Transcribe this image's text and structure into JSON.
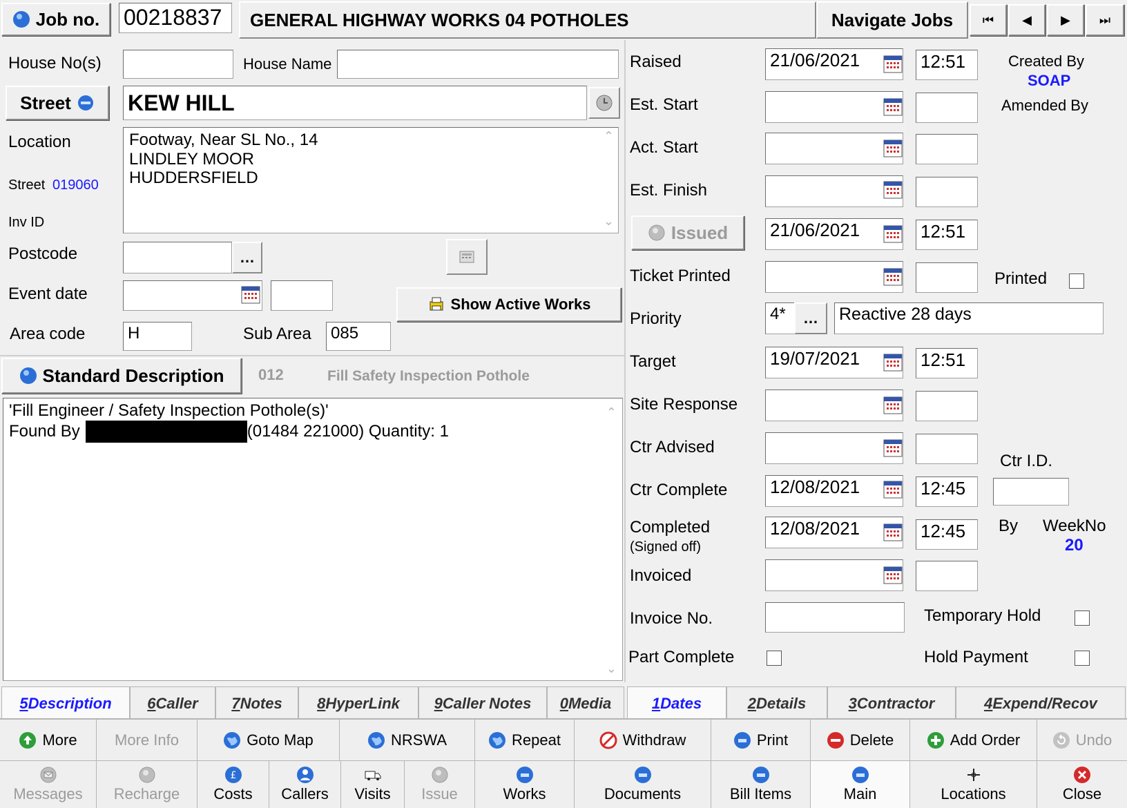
{
  "header": {
    "job_no_label": "Job no.",
    "job_no_value": "00218837",
    "job_title": "GENERAL HIGHWAY WORKS  04 POTHOLES",
    "navigate_label": "Navigate Jobs"
  },
  "address": {
    "house_nos_label": "House No(s)",
    "house_nos_value": "",
    "house_name_label": "House Name",
    "house_name_value": "",
    "street_button": "Street",
    "street_value": "KEW HILL",
    "location_label": "Location",
    "location_lines": [
      "Footway, Near SL No., 14",
      "LINDLEY MOOR",
      "HUDDERSFIELD"
    ],
    "street_code_label": "Street",
    "street_code_value": "019060",
    "inv_id_label": "Inv ID",
    "postcode_label": "Postcode",
    "postcode_value": "",
    "event_date_label": "Event date",
    "area_code_label": "Area code",
    "area_code_value": "H",
    "sub_area_label": "Sub Area",
    "sub_area_value": "085",
    "show_active_works": "Show Active Works"
  },
  "description": {
    "button": "Standard Description",
    "code": "012",
    "text": "Fill Safety Inspection Pothole",
    "body_line1": "'Fill Engineer / Safety Inspection Pothole(s)'",
    "body_line2_prefix": "Found By",
    "body_line2_suffix": "(01484 221000) Quantity: 1"
  },
  "dates": {
    "raised_label": "Raised",
    "raised_date": "21/06/2021",
    "raised_time": "12:51",
    "created_by_label": "Created By",
    "created_by_value": "SOAP",
    "amended_by_label": "Amended By",
    "est_start_label": "Est. Start",
    "act_start_label": "Act. Start",
    "est_finish_label": "Est. Finish",
    "issued_button": "Issued",
    "issued_date": "21/06/2021",
    "issued_time": "12:51",
    "ticket_printed_label": "Ticket Printed",
    "printed_label": "Printed",
    "priority_label": "Priority",
    "priority_code": "4*",
    "priority_text": "Reactive 28 days",
    "target_label": "Target",
    "target_date": "19/07/2021",
    "target_time": "12:51",
    "site_response_label": "Site Response",
    "ctr_advised_label": "Ctr Advised",
    "ctr_id_label": "Ctr I.D.",
    "ctr_complete_label": "Ctr Complete",
    "ctr_complete_date": "12/08/2021",
    "ctr_complete_time": "12:45",
    "completed_label": "Completed",
    "signed_off_label": "(Signed off)",
    "completed_date": "12/08/2021",
    "completed_time": "12:45",
    "by_label": "By",
    "weekno_label": "WeekNo",
    "weekno_value": "20",
    "invoiced_label": "Invoiced",
    "invoice_no_label": "Invoice No.",
    "temporary_hold_label": "Temporary Hold",
    "part_complete_label": "Part Complete",
    "hold_payment_label": "Hold Payment"
  },
  "tabs_left": [
    {
      "key": "5",
      "label": " Description"
    },
    {
      "key": "6",
      "label": " Caller"
    },
    {
      "key": "7",
      "label": " Notes"
    },
    {
      "key": "8",
      "label": " HyperLink"
    },
    {
      "key": "9",
      "label": " Caller Notes"
    },
    {
      "key": "0",
      "label": " Media"
    }
  ],
  "tabs_right": [
    {
      "key": "1",
      "label": " Dates"
    },
    {
      "key": "2",
      "label": " Details"
    },
    {
      "key": "3",
      "label": " Contractor"
    },
    {
      "key": "4",
      "label": " Expend/Recov"
    }
  ],
  "actions": {
    "more": "More",
    "more_info": "More Info",
    "goto_map": "Goto Map",
    "nrswa": "NRSWA",
    "repeat": "Repeat",
    "withdraw": "Withdraw",
    "print": "Print",
    "delete": "Delete",
    "add_order": "Add Order",
    "undo": "Undo"
  },
  "nav": {
    "messages": "Messages",
    "recharge": "Recharge",
    "costs": "Costs",
    "callers": "Callers",
    "visits": "Visits",
    "issue": "Issue",
    "works": "Works",
    "documents": "Documents",
    "bill_items": "Bill Items",
    "main": "Main",
    "locations": "Locations",
    "close": "Close"
  },
  "colors": {
    "accent_blue": "#1a1aff",
    "disabled_gray": "#9b9b9b",
    "panel_bg": "#f0f0f0"
  }
}
